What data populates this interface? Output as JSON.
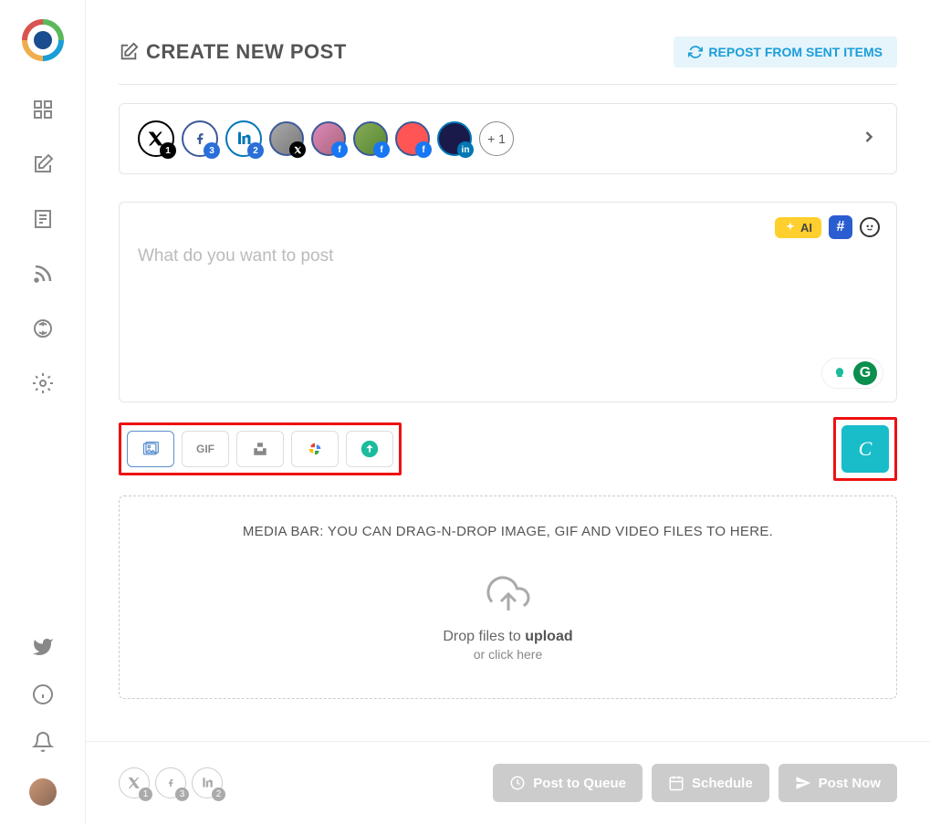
{
  "header": {
    "title": "CREATE NEW POST",
    "repost_label": "REPOST FROM SENT ITEMS"
  },
  "accounts": {
    "x_count": "1",
    "fb_count": "3",
    "li_count": "2",
    "more_label": "+ 1"
  },
  "composer": {
    "placeholder": "What do you want to post",
    "ai_label": "AI",
    "hash_label": "#"
  },
  "media": {
    "bar_text": "MEDIA BAR: YOU CAN DRAG-N-DROP IMAGE, GIF AND VIDEO FILES TO HERE.",
    "gif_label": "GIF",
    "drop_prefix": "Drop files to ",
    "drop_strong": "upload",
    "drop_sub": "or click here",
    "canva_label": "C"
  },
  "footer": {
    "x_count": "1",
    "fb_count": "3",
    "li_count": "2",
    "queue_label": "Post to Queue",
    "schedule_label": "Schedule",
    "now_label": "Post Now"
  }
}
